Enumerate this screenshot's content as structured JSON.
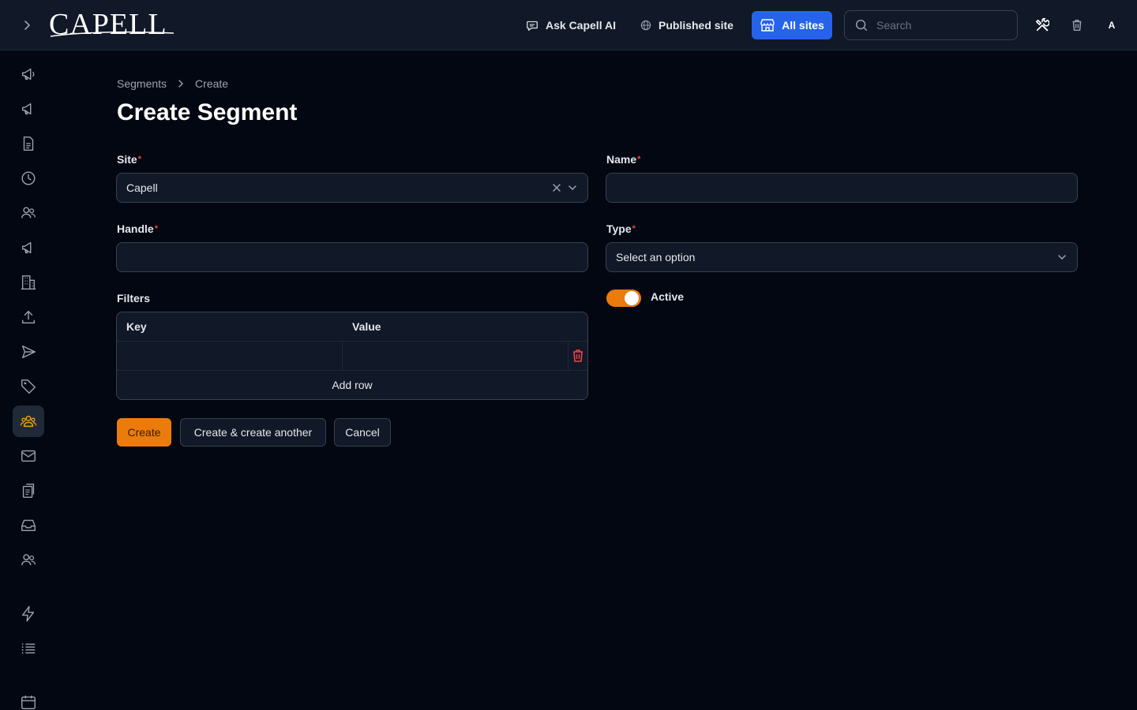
{
  "app": {
    "logo_text": "CAPELL"
  },
  "topbar": {
    "ask_ai_label": "Ask Capell AI",
    "published_site_label": "Published site",
    "all_sites_label": "All sites",
    "search_placeholder": "Search",
    "avatar_initial": "A"
  },
  "sidebar": {
    "items": [
      {
        "icon": "megaphone-icon"
      },
      {
        "icon": "megaphone-icon"
      },
      {
        "icon": "document-icon"
      },
      {
        "icon": "clock-icon"
      },
      {
        "icon": "users-icon"
      },
      {
        "icon": "megaphone-icon"
      },
      {
        "icon": "building-icon"
      },
      {
        "icon": "upload-icon"
      },
      {
        "icon": "paper-plane-icon"
      },
      {
        "icon": "tag-icon"
      },
      {
        "icon": "user-group-icon",
        "active": true
      },
      {
        "icon": "envelope-icon"
      },
      {
        "icon": "clipboard-icon"
      },
      {
        "icon": "inbox-icon"
      },
      {
        "icon": "users-icon"
      },
      {
        "icon": "bolt-icon"
      },
      {
        "icon": "list-icon"
      },
      {
        "icon": "calendar-icon"
      }
    ]
  },
  "breadcrumb": {
    "parent": "Segments",
    "current": "Create"
  },
  "page": {
    "title": "Create Segment"
  },
  "form": {
    "site": {
      "label": "Site",
      "value": "Capell",
      "required_mark": "*"
    },
    "name": {
      "label": "Name",
      "value": "",
      "required_mark": "*"
    },
    "handle": {
      "label": "Handle",
      "value": "",
      "required_mark": "*"
    },
    "type": {
      "label": "Type",
      "placeholder": "Select an option",
      "required_mark": "*"
    },
    "filters": {
      "label": "Filters",
      "columns": [
        "Key",
        "Value"
      ],
      "rows": [
        {
          "key": "",
          "value": ""
        }
      ],
      "add_row_label": "Add row"
    },
    "active": {
      "label": "Active",
      "checked": true
    }
  },
  "actions": {
    "create_label": "Create",
    "create_another_label": "Create & create another",
    "cancel_label": "Cancel"
  },
  "colors": {
    "accent": "#ea7b0c",
    "brand_blue": "#2563eb",
    "danger": "#ef4444",
    "background": "#030712",
    "surface": "#111827"
  }
}
